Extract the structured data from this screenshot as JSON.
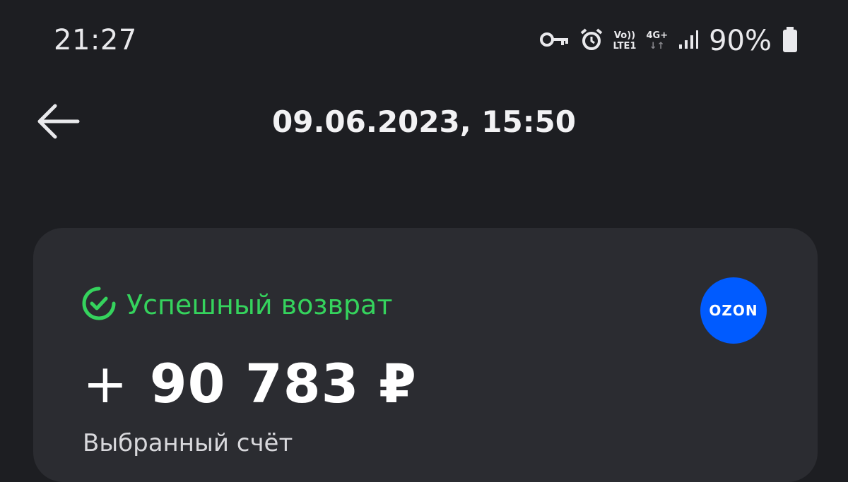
{
  "status_bar": {
    "time": "21:27",
    "volte_label": "Vo))",
    "lte_label": "LTE1",
    "network_label": "4G+",
    "battery_percent": "90%"
  },
  "header": {
    "title": "09.06.2023, 15:50"
  },
  "transaction": {
    "status_text": "Успешный возврат",
    "status_color": "#35d35d",
    "sign": "+",
    "amount": "90 783 ₽",
    "merchant_logo_text": "OZON",
    "merchant_color": "#005bff",
    "subtitle": "Выбранный счёт"
  }
}
